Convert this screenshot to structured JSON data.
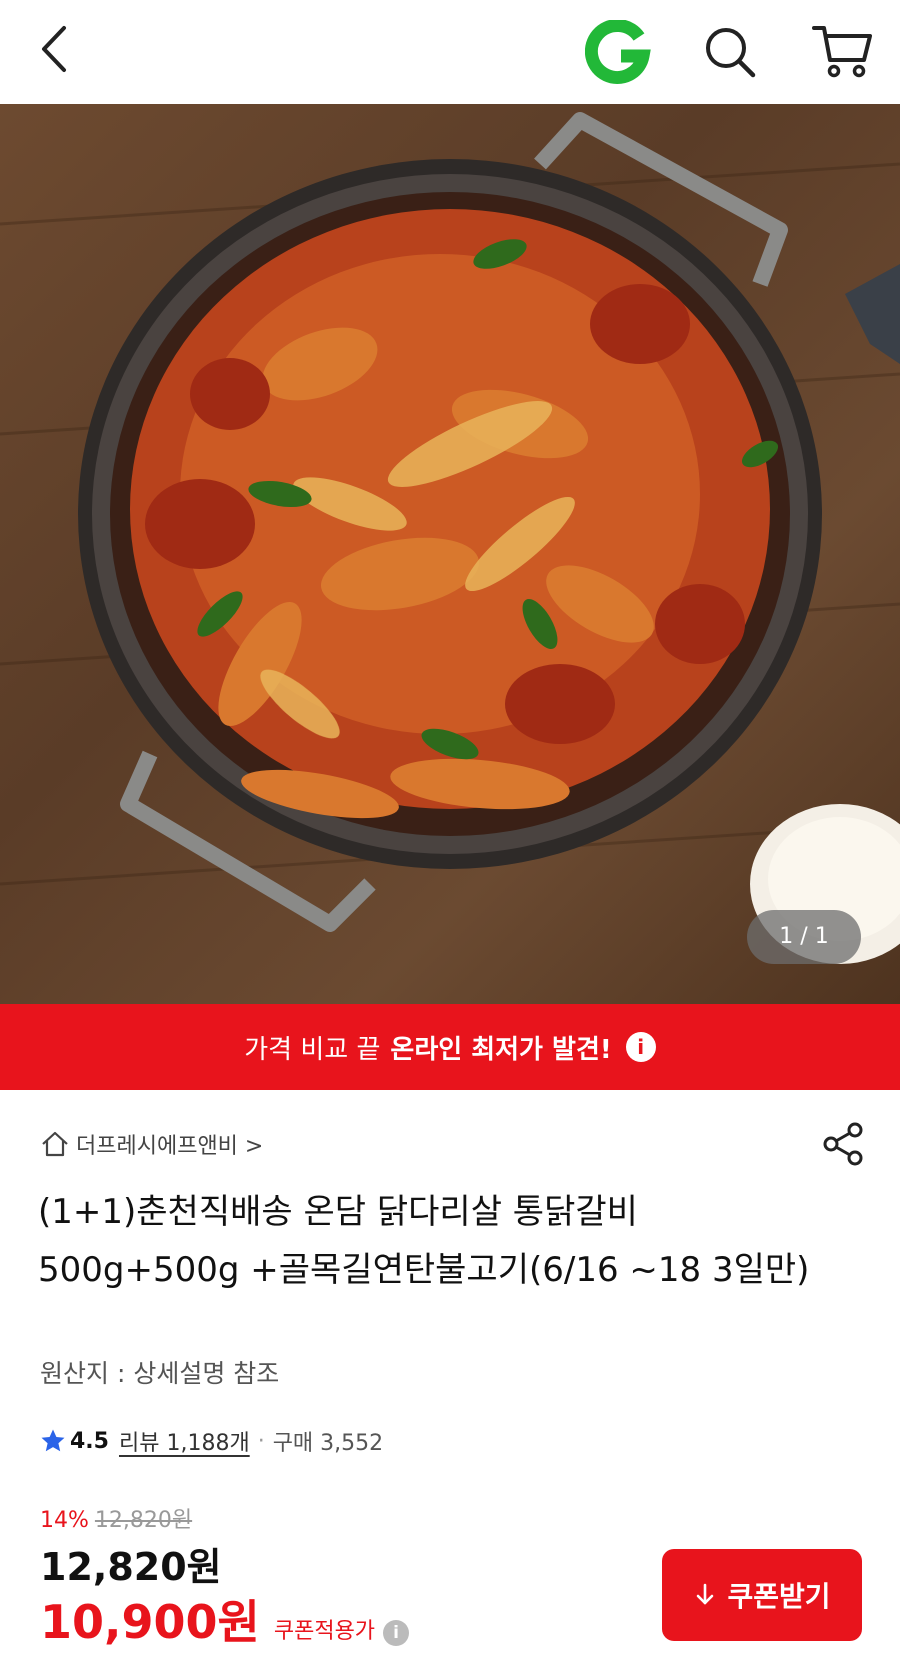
{
  "header": {
    "back_icon": "chevron-left-icon",
    "logo_icon": "gmarket-g-logo",
    "search_icon": "search-icon",
    "cart_icon": "cart-icon",
    "logo_color": "#22b838"
  },
  "gallery": {
    "counter": "1 / 1"
  },
  "banner": {
    "text_plain": "가격 비교 끝",
    "text_bold": "온라인 최저가 발견!",
    "info_icon": "i",
    "color": "#e8141c"
  },
  "seller": {
    "name": "더프레시에프앤비 >",
    "icon": "home-icon"
  },
  "product": {
    "title": "(1+1)춘천직배송 온담 닭다리살 통닭갈비 500g+500g +골목길연탄불고기(6/16 ~18 3일만)",
    "origin": "원산지 : 상세설명 참조"
  },
  "rating": {
    "score": "4.5",
    "reviews": "리뷰 1,188개",
    "separator": "·",
    "purchases": "구매 3,552"
  },
  "pricing": {
    "discount_pct": "14%",
    "original_price": "12,820원",
    "price": "12,820원",
    "coupon_price": "10,900원",
    "coupon_label": "쿠폰적용가",
    "info_icon": "i"
  },
  "actions": {
    "coupon_button": "쿠폰받기"
  }
}
